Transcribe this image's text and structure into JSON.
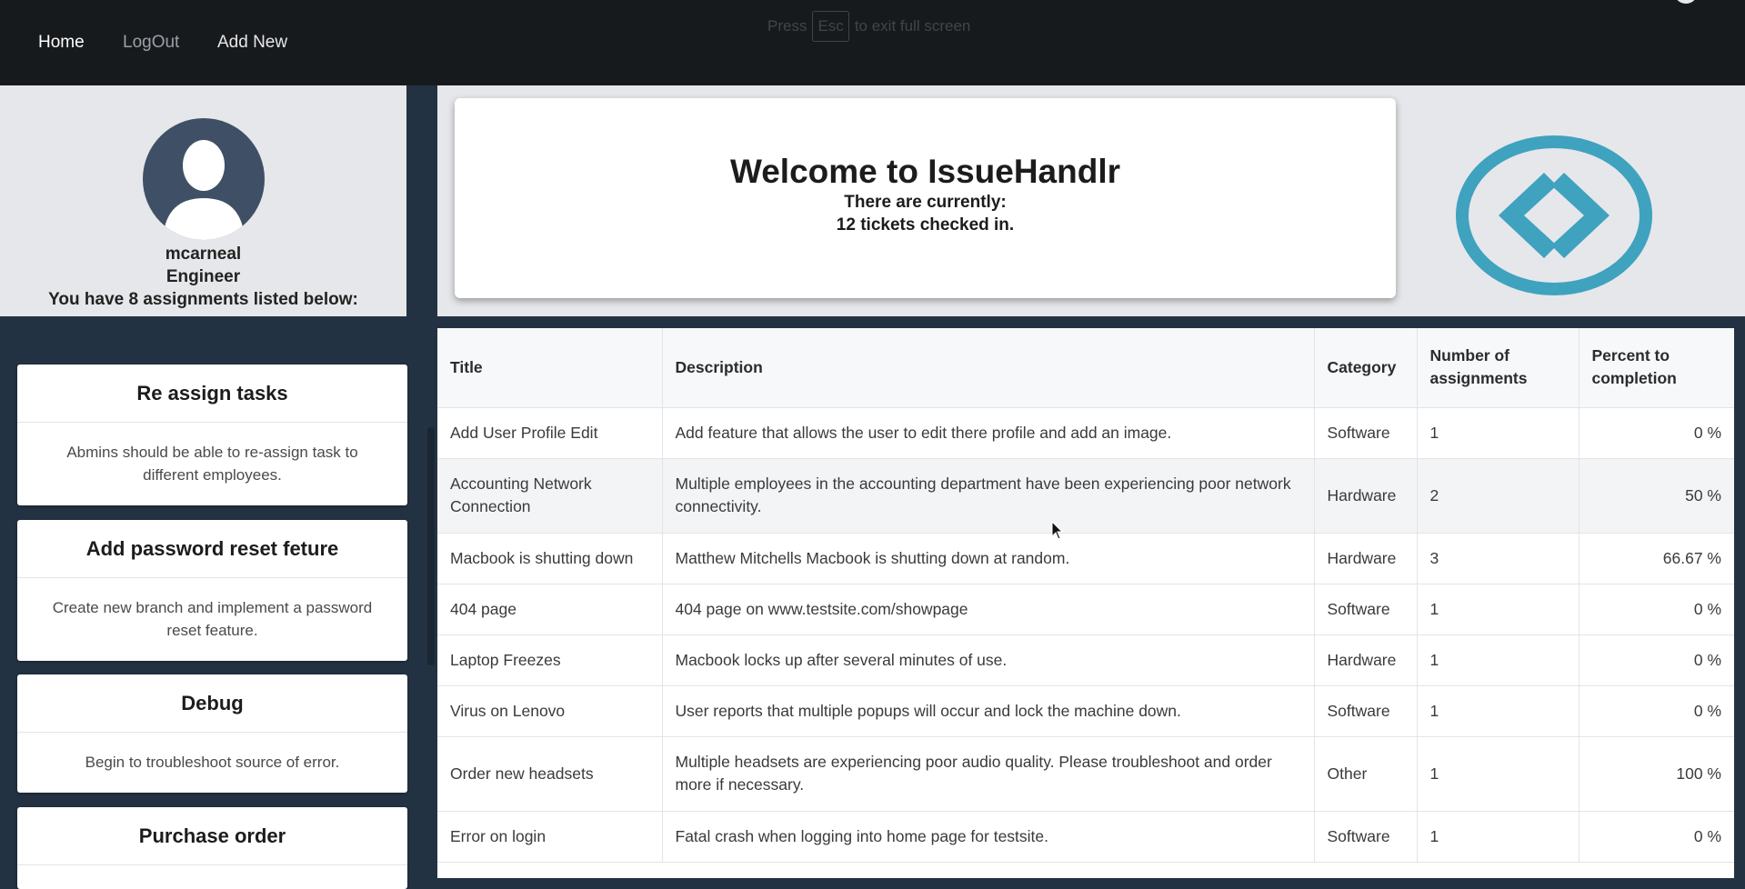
{
  "nav": {
    "home": "Home",
    "logout": "LogOut",
    "add_new": "Add New"
  },
  "fullscreen_hint": {
    "before": "Press",
    "key": "Esc",
    "after": "to exit full screen"
  },
  "profile": {
    "avatar_icon": "user-silhouette-icon",
    "username": "mcarneal",
    "role": "Engineer",
    "assignments_text": "You have 8 assignments listed below:"
  },
  "assignments": [
    {
      "title": "Re assign tasks",
      "body": "Abmins should be able to re-assign task to different employees."
    },
    {
      "title": "Add password reset feture",
      "body": "Create new branch and implement a password reset feature."
    },
    {
      "title": "Debug",
      "body": "Begin to troubleshoot source of error."
    },
    {
      "title": "Purchase order",
      "body": ""
    }
  ],
  "banner": {
    "title": "Welcome to IssueHandlr",
    "line1": "There are currently:",
    "line2": "12 tickets checked in.",
    "logo_icon": "code-brackets-icon",
    "logo_color": "#3fa2bf"
  },
  "table": {
    "headers": {
      "title": "Title",
      "description": "Description",
      "category": "Category",
      "assignments_1": "Number of",
      "assignments_2": "assignments",
      "percent_1": "Percent to",
      "percent_2": "completion"
    },
    "rows": [
      {
        "title": "Add User Profile Edit",
        "description": "Add feature that allows the user to edit there profile and add an image.",
        "category": "Software",
        "assignments": "1",
        "percent": "0 %"
      },
      {
        "title": "Accounting Network Connection",
        "description": "Multiple employees in the accounting department have been experiencing poor network connectivity.",
        "category": "Hardware",
        "assignments": "2",
        "percent": "50 %"
      },
      {
        "title": "Macbook is shutting down",
        "description": "Matthew Mitchells Macbook is shutting down at random.",
        "category": "Hardware",
        "assignments": "3",
        "percent": "66.67 %"
      },
      {
        "title": "404 page",
        "description": "404 page on www.testsite.com/showpage",
        "category": "Software",
        "assignments": "1",
        "percent": "0 %"
      },
      {
        "title": "Laptop Freezes",
        "description": "Macbook locks up after several minutes of use.",
        "category": "Hardware",
        "assignments": "1",
        "percent": "0 %"
      },
      {
        "title": "Virus on Lenovo",
        "description": "User reports that multiple popups will occur and lock the machine down.",
        "category": "Software",
        "assignments": "1",
        "percent": "0 %"
      },
      {
        "title": "Order new headsets",
        "description": "Multiple headsets are experiencing poor audio quality. Please troubleshoot and order more if necessary.",
        "category": "Other",
        "assignments": "1",
        "percent": "100 %"
      },
      {
        "title": "Error on login",
        "description": "Fatal crash when logging into home page for testsite.",
        "category": "Software",
        "assignments": "1",
        "percent": "0 %"
      }
    ]
  },
  "colors": {
    "nav_bg": "#171a1d",
    "page_bg": "#233242",
    "panel_bg": "#e6e7ea",
    "accent": "#3fa2bf"
  }
}
